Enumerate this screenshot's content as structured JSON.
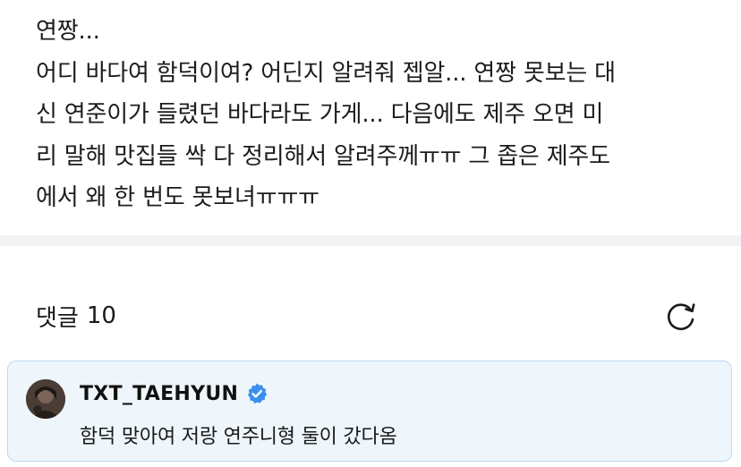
{
  "post": {
    "lines": [
      "연짱...",
      "어디 바다여 함덕이여? 어딘지 알려줘 젭알... 연짱 못보는 대",
      "신 연준이가 들렸던 바다라도 가게... 다음에도 제주 오면 미",
      "리 말해 맛집들 싹 다 정리해서 알려주께ㅠㅠ 그 좁은 제주도",
      "에서 왜 한 번도 못보녀ㅠㅠㅠ"
    ]
  },
  "comments": {
    "label": "댓글",
    "count": "10",
    "refresh_icon": "refresh-icon",
    "items": [
      {
        "author": "TXT_TAEHYUN",
        "verified": true,
        "verified_icon": "verified-badge-icon",
        "text": "함덕 맞아여 저랑 연주니형 둘이 갔다옴"
      }
    ]
  },
  "colors": {
    "text": "#1c1c1c",
    "divider": "#f2f2f4",
    "card_background": "#eef6fc",
    "card_border": "#bcd9f0",
    "verified_blue": "#3b8ef0"
  }
}
